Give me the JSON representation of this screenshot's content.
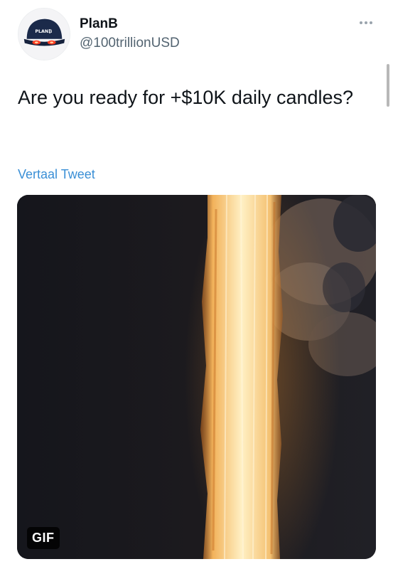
{
  "user": {
    "name": "PlanB",
    "handle": "@100trillionUSD",
    "avatar_cap_text": "PLAN₿"
  },
  "tweet": {
    "text": "Are you ready for +$10K daily candles?",
    "translate_label": "Vertaal Tweet"
  },
  "media": {
    "badge": "GIF",
    "description_icon": "rocket-exhaust-flame"
  },
  "colors": {
    "text": "#0f1419",
    "secondary": "#536471",
    "link": "#3a8fd6"
  }
}
